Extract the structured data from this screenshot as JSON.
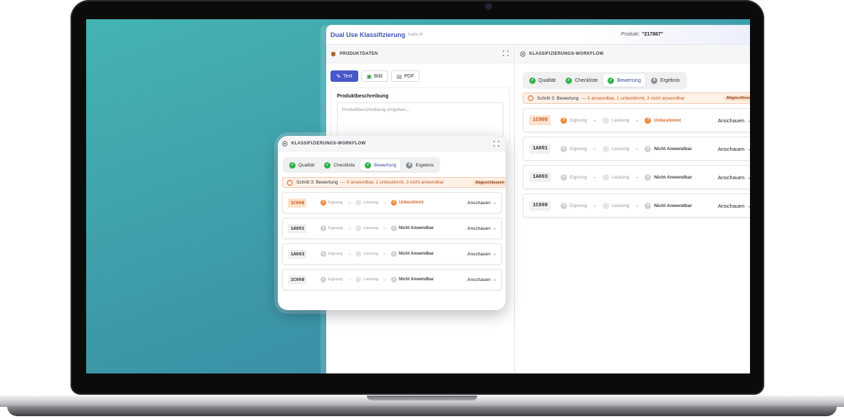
{
  "app": {
    "brand": "Dual Use Klassifizierung",
    "brand_sub": "trade AI",
    "product_label": "Produkt:",
    "product_value": "\"217867\""
  },
  "left_panel": {
    "title": "PRODUKTDATEN",
    "buttons": [
      {
        "label": "Text",
        "icon": "text-icon",
        "active": true
      },
      {
        "label": "Bild",
        "icon": "image-icon",
        "active": false
      },
      {
        "label": "PDF",
        "icon": "pdf-icon",
        "active": false
      }
    ],
    "description_label": "Produktbeschreibung",
    "description_placeholder": "Produktbeschreibung eingeben..."
  },
  "workflow": {
    "title": "KLASSIFIZIERUNGS-WORKFLOW",
    "tabs": [
      {
        "label": "Qualität",
        "state": "done"
      },
      {
        "label": "Checkliste",
        "state": "done"
      },
      {
        "label": "Bewertung",
        "state": "done",
        "selected": true
      },
      {
        "label": "Ergebnis",
        "state": "number",
        "number": "4"
      }
    ],
    "status_step": "Schritt 3: Bewertung",
    "status_sep": "—",
    "status_detail_right": "0 anwendbar, 1 unbestimmt, 3 nicht anwendbar",
    "status_detail_card": "0 anwendbar, 1 unbestimmt, 3 nicht anwendbar",
    "status_badge_right": "Abgeschloss",
    "status_badge_card": "Abgeschlossen",
    "step_eignung": "Eignung",
    "step_leistung": "Leistung",
    "arrow": "→",
    "view_label_right": "Anschauen →",
    "view_label_card": "Anschauen →",
    "rows": [
      {
        "code": "1C008",
        "result": "Unbestimmt",
        "state": "unknown",
        "eignung_mark": "?",
        "result_mark": "?"
      },
      {
        "code": "1A001",
        "result": "Nicht Anwendbar",
        "state": "na",
        "eignung_mark": "×",
        "result_mark": "×"
      },
      {
        "code": "1A003",
        "result": "Nicht Anwendbar",
        "state": "na",
        "eignung_mark": "×",
        "result_mark": "×"
      },
      {
        "code": "1C009",
        "result": "Nicht Anwendbar",
        "state": "na",
        "eignung_mark": "×",
        "result_mark": "×"
      }
    ]
  },
  "colors": {
    "accent": "#4856c9",
    "brand": "#3c56b5",
    "success": "#2fb24c",
    "warning": "#ee8a3c",
    "background_teal": "#44b3b2"
  }
}
